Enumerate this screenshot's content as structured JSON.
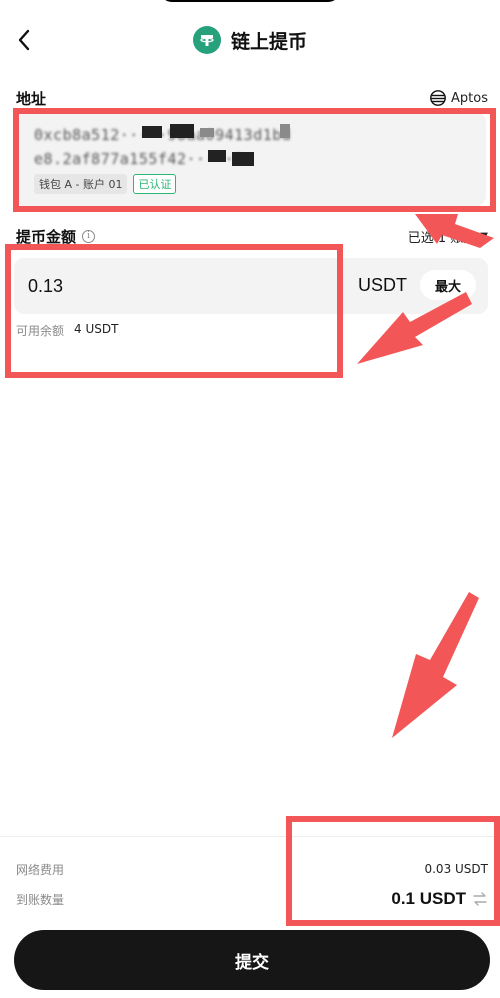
{
  "header": {
    "title": "链上提币",
    "back_icon": "chevron-left-icon",
    "logo_icon": "usdt-tether-icon"
  },
  "address": {
    "label": "地址",
    "network": "Aptos",
    "network_icon": "aptos-icon",
    "line1": "0xcb8a512·····98aa09413d1bd",
    "line2": "e8.2af877a155f42·····9",
    "wallet_tag": "钱包 A - 账户 01",
    "verified_tag": "已认证"
  },
  "amount": {
    "label": "提币金额",
    "selected_accounts": "已选 1 账户",
    "value": "0.13",
    "unit": "USDT",
    "max_label": "最大",
    "available_label": "可用余额",
    "available_value": "4 USDT"
  },
  "summary": {
    "fee_label": "网络费用",
    "fee_value": "0.03 USDT",
    "receive_label": "到账数量",
    "receive_value": "0.1 USDT"
  },
  "submit_label": "提交",
  "colors": {
    "accent": "#161616",
    "usdt_green": "#26a17b",
    "verified_green": "#2bb673",
    "annotation_red": "#f25656",
    "field_bg": "#f3f3f3"
  }
}
